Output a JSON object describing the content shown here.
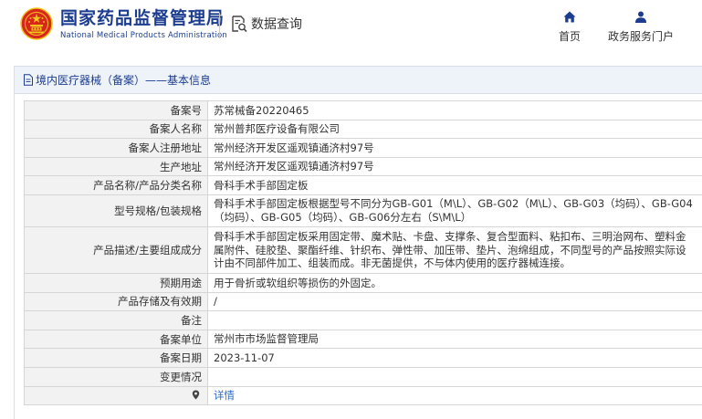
{
  "header": {
    "brand_cn": "国家药品监督管理局",
    "brand_en": "National Medical Products Administration",
    "query_label": "数据查询",
    "nav_home": "首页",
    "nav_portal": "政务服务门户"
  },
  "panel": {
    "title": "境内医疗器械（备案）——基本信息"
  },
  "rows": [
    {
      "label": "备案号",
      "value": "苏常械备20220465"
    },
    {
      "label": "备案人名称",
      "value": "常州普邦医疗设备有限公司"
    },
    {
      "label": "备案人注册地址",
      "value": "常州经济开发区遥观镇通济村97号"
    },
    {
      "label": "生产地址",
      "value": "常州经济开发区遥观镇通济村97号"
    },
    {
      "label": "产品名称/产品分类名称",
      "value": "骨科手术手部固定板"
    },
    {
      "label": "型号规格/包装规格",
      "value": "骨科手术手部固定板根据型号不同分为GB-G01（M\\L）、GB-G02（M\\L）、GB-G03（均码）、GB-G04（均码）、GB-G05（均码）、GB-G06分左右（S\\M\\L）"
    },
    {
      "label": "产品描述/主要组成成分",
      "value": "骨科手术手部固定板采用固定带、魔术贴、卡盘、支撑条、复合型面料、粘扣布、三明治网布、塑料金属附件、硅胶垫、聚酯纤维、针织布、弹性带、加压带、垫片、泡绵组成，不同型号的产品按照实际设计由不同部件加工、组装而成。非无菌提供，不与体内使用的医疗器械连接。"
    },
    {
      "label": "预期用途",
      "value": "用于骨折或软组织等损伤的外固定。"
    },
    {
      "label": "产品存储及有效期",
      "value": "/"
    },
    {
      "label": "备注",
      "value": ""
    },
    {
      "label": "备案单位",
      "value": "常州市市场监督管理局"
    },
    {
      "label": "备案日期",
      "value": "2023-11-07"
    },
    {
      "label": "变更情况",
      "value": ""
    },
    {
      "label": "",
      "value": "详情"
    }
  ],
  "colors": {
    "brand_blue": "#1c3d8f",
    "emblem_red": "#d7261e",
    "emblem_gold": "#f2c318",
    "label_bg": "#f2f2f2",
    "link_blue": "#2b6cc4"
  }
}
